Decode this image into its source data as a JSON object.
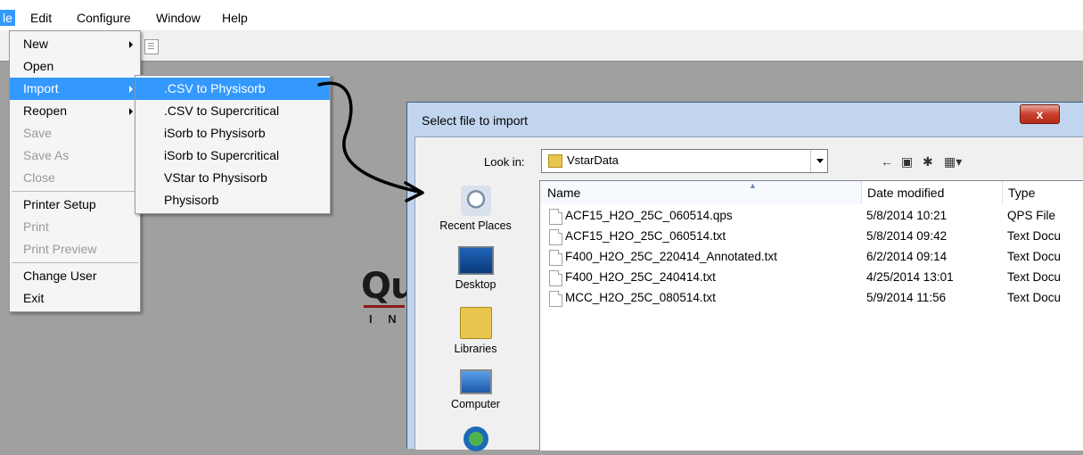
{
  "menubar": {
    "items": [
      {
        "label": "le"
      },
      {
        "label": "Edit"
      },
      {
        "label": "Configure"
      },
      {
        "label": "Window"
      },
      {
        "label": "Help"
      }
    ]
  },
  "file_menu": {
    "items": [
      {
        "label": "New"
      },
      {
        "label": "Open"
      },
      {
        "label": "Import"
      },
      {
        "label": "Reopen"
      },
      {
        "label": "Save"
      },
      {
        "label": "Save As"
      },
      {
        "label": "Close"
      },
      {
        "label": "Printer Setup"
      },
      {
        "label": "Print"
      },
      {
        "label": "Print Preview"
      },
      {
        "label": "Change User"
      },
      {
        "label": "Exit"
      }
    ]
  },
  "import_menu": {
    "items": [
      {
        "label": ".CSV to Physisorb"
      },
      {
        "label": ".CSV to Supercritical"
      },
      {
        "label": "iSorb to Physisorb"
      },
      {
        "label": "iSorb to Supercritical"
      },
      {
        "label": "VStar to Physisorb"
      },
      {
        "label": "Physisorb"
      }
    ]
  },
  "logo": {
    "text": "Qu",
    "sub": "I N S"
  },
  "dialog": {
    "title": "Select file to import",
    "close_label": "x",
    "look_in_label": "Look in:",
    "look_in_value": "VstarData",
    "places": [
      {
        "label": "Recent Places"
      },
      {
        "label": "Desktop"
      },
      {
        "label": "Libraries"
      },
      {
        "label": "Computer"
      }
    ],
    "columns": {
      "name": "Name",
      "date": "Date modified",
      "type": "Type"
    },
    "files": [
      {
        "name": "ACF15_H2O_25C_060514.qps",
        "date": "5/8/2014 10:21",
        "type": "QPS File"
      },
      {
        "name": "ACF15_H2O_25C_060514.txt",
        "date": "5/8/2014 09:42",
        "type": "Text Docu"
      },
      {
        "name": "F400_H2O_25C_220414_Annotated.txt",
        "date": "6/2/2014 09:14",
        "type": "Text Docu"
      },
      {
        "name": "F400_H2O_25C_240414.txt",
        "date": "4/25/2014 13:01",
        "type": "Text Docu"
      },
      {
        "name": "MCC_H2O_25C_080514.txt",
        "date": "5/9/2014 11:56",
        "type": "Text Docu"
      }
    ]
  }
}
